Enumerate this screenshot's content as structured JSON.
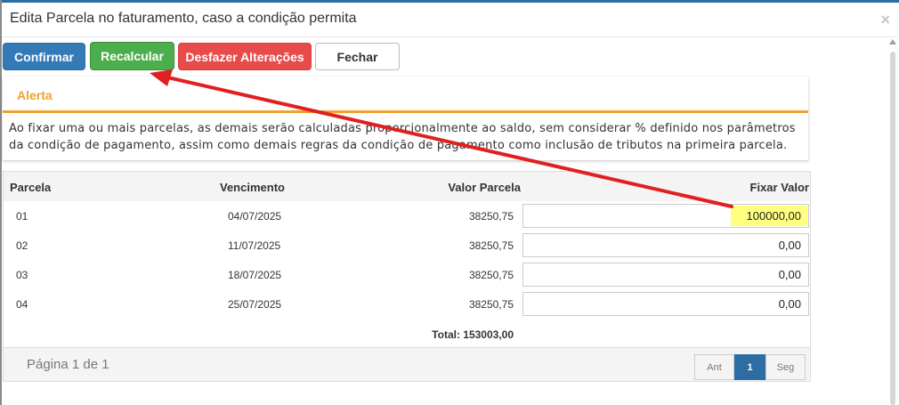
{
  "dialog": {
    "title": "Edita Parcela no faturamento, caso a condição permita",
    "close_symbol": "×"
  },
  "toolbar": {
    "confirm_label": "Confirmar",
    "recalc_label": "Recalcular",
    "undo_label": "Desfazer Alterações",
    "close_label": "Fechar"
  },
  "alert": {
    "title": "Alerta",
    "line1": "Ao fixar uma ou mais parcelas, as demais serão calculadas proporcionalmente ao saldo, sem considerar % definido nos parâmetros",
    "line2": "da condição de pagamento, assim como demais regras da condição de pagamento como inclusão de tributos na primeira parcela."
  },
  "table": {
    "headers": {
      "parcela": "Parcela",
      "vencimento": "Vencimento",
      "valor": "Valor Parcela",
      "fixar": "Fixar Valor"
    },
    "rows": [
      {
        "parcela": "01",
        "vencimento": "04/07/2025",
        "valor": "38250,75",
        "fixar": "100000,00"
      },
      {
        "parcela": "02",
        "vencimento": "11/07/2025",
        "valor": "38250,75",
        "fixar": "0,00"
      },
      {
        "parcela": "03",
        "vencimento": "18/07/2025",
        "valor": "38250,75",
        "fixar": "0,00"
      },
      {
        "parcela": "04",
        "vencimento": "25/07/2025",
        "valor": "38250,75",
        "fixar": "0,00"
      }
    ],
    "total": "Total: 153003,00"
  },
  "pagination": {
    "info": "Página 1 de 1",
    "prev": "Ant",
    "current": "1",
    "next": "Seg"
  },
  "colors": {
    "primary": "#337ab7",
    "success": "#4cae4c",
    "danger": "#e84b4b",
    "alert_accent": "#f0a030",
    "highlight": "#ffff80",
    "annotation_arrow": "#e02020"
  }
}
